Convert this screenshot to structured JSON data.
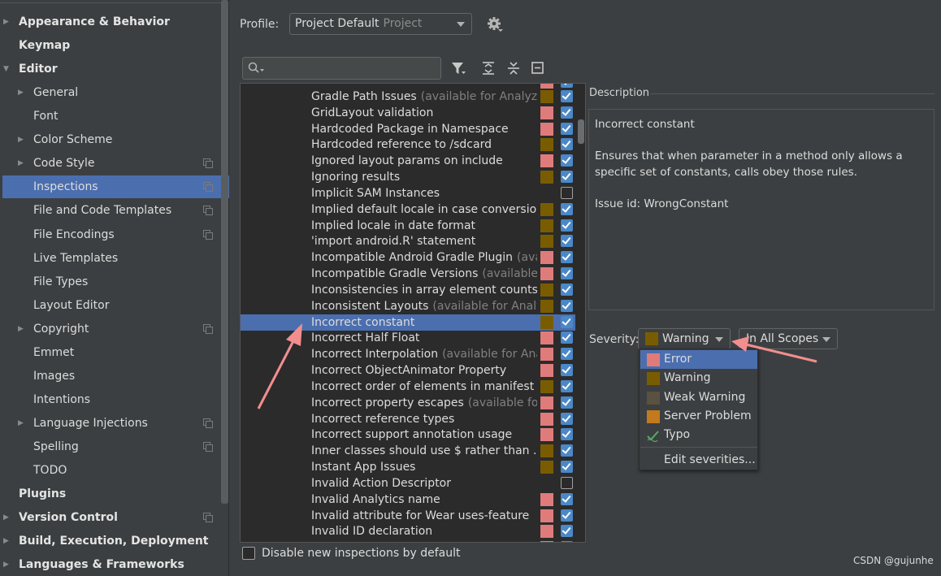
{
  "sidebar": {
    "items": [
      {
        "label": "Appearance & Behavior",
        "bold": true,
        "arrow": "right",
        "indent": 0,
        "copy": false
      },
      {
        "label": "Keymap",
        "bold": true,
        "arrow": "",
        "indent": 0,
        "copy": false
      },
      {
        "label": "Editor",
        "bold": true,
        "arrow": "down",
        "indent": 0,
        "copy": false
      },
      {
        "label": "General",
        "bold": false,
        "arrow": "right",
        "indent": 1,
        "copy": false
      },
      {
        "label": "Font",
        "bold": false,
        "arrow": "",
        "indent": 1,
        "copy": false
      },
      {
        "label": "Color Scheme",
        "bold": false,
        "arrow": "right",
        "indent": 1,
        "copy": false
      },
      {
        "label": "Code Style",
        "bold": false,
        "arrow": "right",
        "indent": 1,
        "copy": true
      },
      {
        "label": "Inspections",
        "bold": false,
        "arrow": "",
        "indent": 1,
        "copy": true,
        "selected": true
      },
      {
        "label": "File and Code Templates",
        "bold": false,
        "arrow": "",
        "indent": 1,
        "copy": true
      },
      {
        "label": "File Encodings",
        "bold": false,
        "arrow": "",
        "indent": 1,
        "copy": true
      },
      {
        "label": "Live Templates",
        "bold": false,
        "arrow": "",
        "indent": 1,
        "copy": false
      },
      {
        "label": "File Types",
        "bold": false,
        "arrow": "",
        "indent": 1,
        "copy": false
      },
      {
        "label": "Layout Editor",
        "bold": false,
        "arrow": "",
        "indent": 1,
        "copy": false
      },
      {
        "label": "Copyright",
        "bold": false,
        "arrow": "right",
        "indent": 1,
        "copy": true
      },
      {
        "label": "Emmet",
        "bold": false,
        "arrow": "",
        "indent": 1,
        "copy": false
      },
      {
        "label": "Images",
        "bold": false,
        "arrow": "",
        "indent": 1,
        "copy": false
      },
      {
        "label": "Intentions",
        "bold": false,
        "arrow": "",
        "indent": 1,
        "copy": false
      },
      {
        "label": "Language Injections",
        "bold": false,
        "arrow": "right",
        "indent": 1,
        "copy": true
      },
      {
        "label": "Spelling",
        "bold": false,
        "arrow": "",
        "indent": 1,
        "copy": true
      },
      {
        "label": "TODO",
        "bold": false,
        "arrow": "",
        "indent": 1,
        "copy": false
      },
      {
        "label": "Plugins",
        "bold": true,
        "arrow": "",
        "indent": 0,
        "copy": false
      },
      {
        "label": "Version Control",
        "bold": true,
        "arrow": "right",
        "indent": 0,
        "copy": true
      },
      {
        "label": "Build, Execution, Deployment",
        "bold": true,
        "arrow": "right",
        "indent": 0,
        "copy": false
      },
      {
        "label": "Languages & Frameworks",
        "bold": true,
        "arrow": "right",
        "indent": 0,
        "copy": false
      }
    ]
  },
  "profile": {
    "label": "Profile:",
    "value": "Project Default",
    "sub": "Project"
  },
  "search": {
    "placeholder": ""
  },
  "inspections": [
    {
      "name": "Gradle Path Issues",
      "extra": "(available for Analyze|",
      "sev": "warning",
      "checked": true
    },
    {
      "name": "GridLayout validation",
      "extra": "",
      "sev": "error",
      "checked": true
    },
    {
      "name": "Hardcoded Package in Namespace",
      "extra": "",
      "sev": "error",
      "checked": true
    },
    {
      "name": "Hardcoded reference to /sdcard",
      "extra": "",
      "sev": "warning",
      "checked": true
    },
    {
      "name": "Ignored layout params on include",
      "extra": "",
      "sev": "error",
      "checked": true
    },
    {
      "name": "Ignoring results",
      "extra": "",
      "sev": "warning",
      "checked": true
    },
    {
      "name": "Implicit SAM Instances",
      "extra": "",
      "sev": "",
      "checked": false
    },
    {
      "name": "Implied default locale in case conversion",
      "extra": "",
      "sev": "warning",
      "checked": true
    },
    {
      "name": "Implied locale in date format",
      "extra": "",
      "sev": "warning",
      "checked": true
    },
    {
      "name": "'import android.R' statement",
      "extra": "",
      "sev": "warning",
      "checked": true
    },
    {
      "name": "Incompatible Android Gradle Plugin",
      "extra": "(avai",
      "sev": "error",
      "checked": true
    },
    {
      "name": "Incompatible Gradle Versions",
      "extra": "(available f",
      "sev": "error",
      "checked": true
    },
    {
      "name": "Inconsistencies in array element counts",
      "extra": "",
      "sev": "warning",
      "checked": true
    },
    {
      "name": "Inconsistent Layouts",
      "extra": "(available for Analyz",
      "sev": "warning",
      "checked": true
    },
    {
      "name": "Incorrect constant",
      "extra": "",
      "sev": "warning",
      "checked": true,
      "selected": true
    },
    {
      "name": "Incorrect Half Float",
      "extra": "",
      "sev": "error",
      "checked": true
    },
    {
      "name": "Incorrect Interpolation",
      "extra": "(available for Anal",
      "sev": "error",
      "checked": true
    },
    {
      "name": "Incorrect ObjectAnimator Property",
      "extra": "",
      "sev": "error",
      "checked": true
    },
    {
      "name": "Incorrect order of elements in manifest",
      "extra": "",
      "sev": "warning",
      "checked": true
    },
    {
      "name": "Incorrect property escapes",
      "extra": "(available for",
      "sev": "error",
      "checked": true
    },
    {
      "name": "Incorrect reference types",
      "extra": "",
      "sev": "error",
      "checked": true
    },
    {
      "name": "Incorrect support annotation usage",
      "extra": "",
      "sev": "error",
      "checked": true
    },
    {
      "name": "Inner classes should use $ rather than .",
      "extra": "",
      "sev": "warning",
      "checked": true
    },
    {
      "name": "Instant App Issues",
      "extra": "",
      "sev": "warning",
      "checked": true
    },
    {
      "name": "Invalid Action Descriptor",
      "extra": "",
      "sev": "",
      "checked": false
    },
    {
      "name": "Invalid Analytics name",
      "extra": "",
      "sev": "error",
      "checked": true
    },
    {
      "name": "Invalid attribute for Wear uses-feature",
      "extra": "",
      "sev": "error",
      "checked": true
    },
    {
      "name": "Invalid ID declaration",
      "extra": "",
      "sev": "error",
      "checked": true
    }
  ],
  "bottom_checkbox": "Disable new inspections by default",
  "description": {
    "label": "Description",
    "title": "Incorrect constant",
    "body": "Ensures that when parameter in a method only allows a specific set of constants, calls obey those rules.",
    "issue": "Issue id: WrongConstant"
  },
  "severity": {
    "label": "Severity:",
    "value": "Warning",
    "scope": "In All Scopes",
    "options": [
      {
        "label": "Error",
        "color": "#e07b7b",
        "highlighted": true
      },
      {
        "label": "Warning",
        "color": "#7a5c00"
      },
      {
        "label": "Weak Warning",
        "color": "#5a5140"
      },
      {
        "label": "Server Problem",
        "color": "#c27a1d"
      },
      {
        "label": "Typo",
        "color": "",
        "icon": "typo-check-icon"
      }
    ],
    "edit": "Edit severities..."
  },
  "colors": {
    "error": "#e07b7b",
    "warning": "#7a5c00",
    "accent": "#4b6eaf"
  },
  "watermark": "CSDN @gujunhe"
}
